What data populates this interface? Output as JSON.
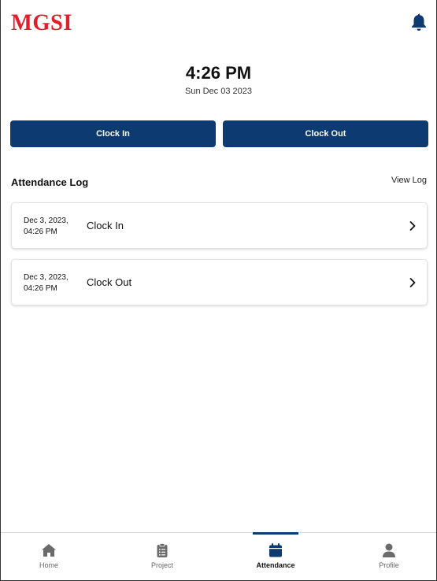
{
  "header": {
    "logo_text": "MGSI",
    "logo_color": "#e21e2a",
    "notification_icon": "bell-icon"
  },
  "clock": {
    "time": "4:26 PM",
    "date": "Sun Dec 03 2023"
  },
  "actions": {
    "clock_in_label": "Clock In",
    "clock_out_label": "Clock Out",
    "button_color": "#0d3a70"
  },
  "attendance_log": {
    "title": "Attendance Log",
    "view_log_label": "View Log",
    "entries": [
      {
        "date_line1": "Dec 3, 2023,",
        "date_line2": "04:26 PM",
        "label": "Clock In",
        "icon": "chevron-right-icon"
      },
      {
        "date_line1": "Dec 3, 2023,",
        "date_line2": "04:26 PM",
        "label": "Clock Out",
        "icon": "chevron-right-icon"
      }
    ]
  },
  "bottom_nav": {
    "active": "Attendance",
    "items": [
      {
        "label": "Home",
        "icon": "home-icon"
      },
      {
        "label": "Project",
        "icon": "clipboard-icon"
      },
      {
        "label": "Attendance",
        "icon": "calendar-icon"
      },
      {
        "label": "Profile",
        "icon": "user-icon"
      }
    ]
  }
}
